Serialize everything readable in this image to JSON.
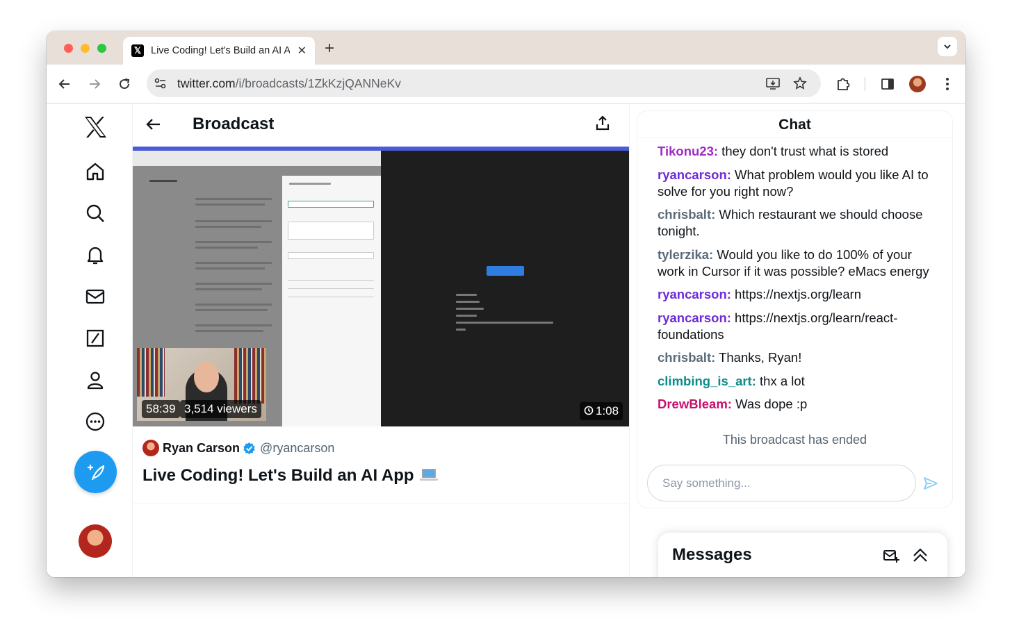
{
  "browser": {
    "tab_title": "Live Coding! Let's Build an AI App",
    "url_host": "twitter.com",
    "url_path": "/i/broadcasts/1ZkKzjQANNeKv"
  },
  "main": {
    "header_title": "Broadcast",
    "video": {
      "elapsed": "58:39",
      "viewers": "3,514 viewers",
      "replay": "1:08"
    },
    "author": {
      "name": "Ryan Carson",
      "handle": "@ryancarson"
    },
    "post_title": "Live Coding! Let's Build an AI App"
  },
  "chat": {
    "title": "Chat",
    "messages": [
      {
        "user": "Tikonu23:",
        "text": " they don't trust what is stored",
        "color": "#9e2bc4"
      },
      {
        "user": "ryancarson:",
        "text": " What problem would you like AI to solve for you right now?",
        "color": "#6d2bd9"
      },
      {
        "user": "chrisbalt:",
        "text": " Which restaurant we should choose tonight.",
        "color": "#5b6b7a"
      },
      {
        "user": "tylerzika:",
        "text": " Would you like to do 100% of your work in Cursor if it was possible? eMacs energy",
        "color": "#5b6b7a"
      },
      {
        "user": "ryancarson:",
        "text": " https://nextjs.org/learn",
        "color": "#6d2bd9"
      },
      {
        "user": "ryancarson:",
        "text": " https://nextjs.org/learn/react-foundations",
        "color": "#6d2bd9"
      },
      {
        "user": "chrisbalt:",
        "text": " Thanks, Ryan!",
        "color": "#5b6b7a"
      },
      {
        "user": "climbing_is_art:",
        "text": " thx a lot",
        "color": "#0f8a8a"
      },
      {
        "user": "DrewBleam:",
        "text": " Was dope :p",
        "color": "#c4126e"
      }
    ],
    "ended_text": "This broadcast has ended",
    "input_placeholder": "Say something..."
  },
  "messages_drawer": {
    "title": "Messages"
  },
  "colors": {
    "accent": "#1d9bf0",
    "verified": "#1d9bf0"
  }
}
